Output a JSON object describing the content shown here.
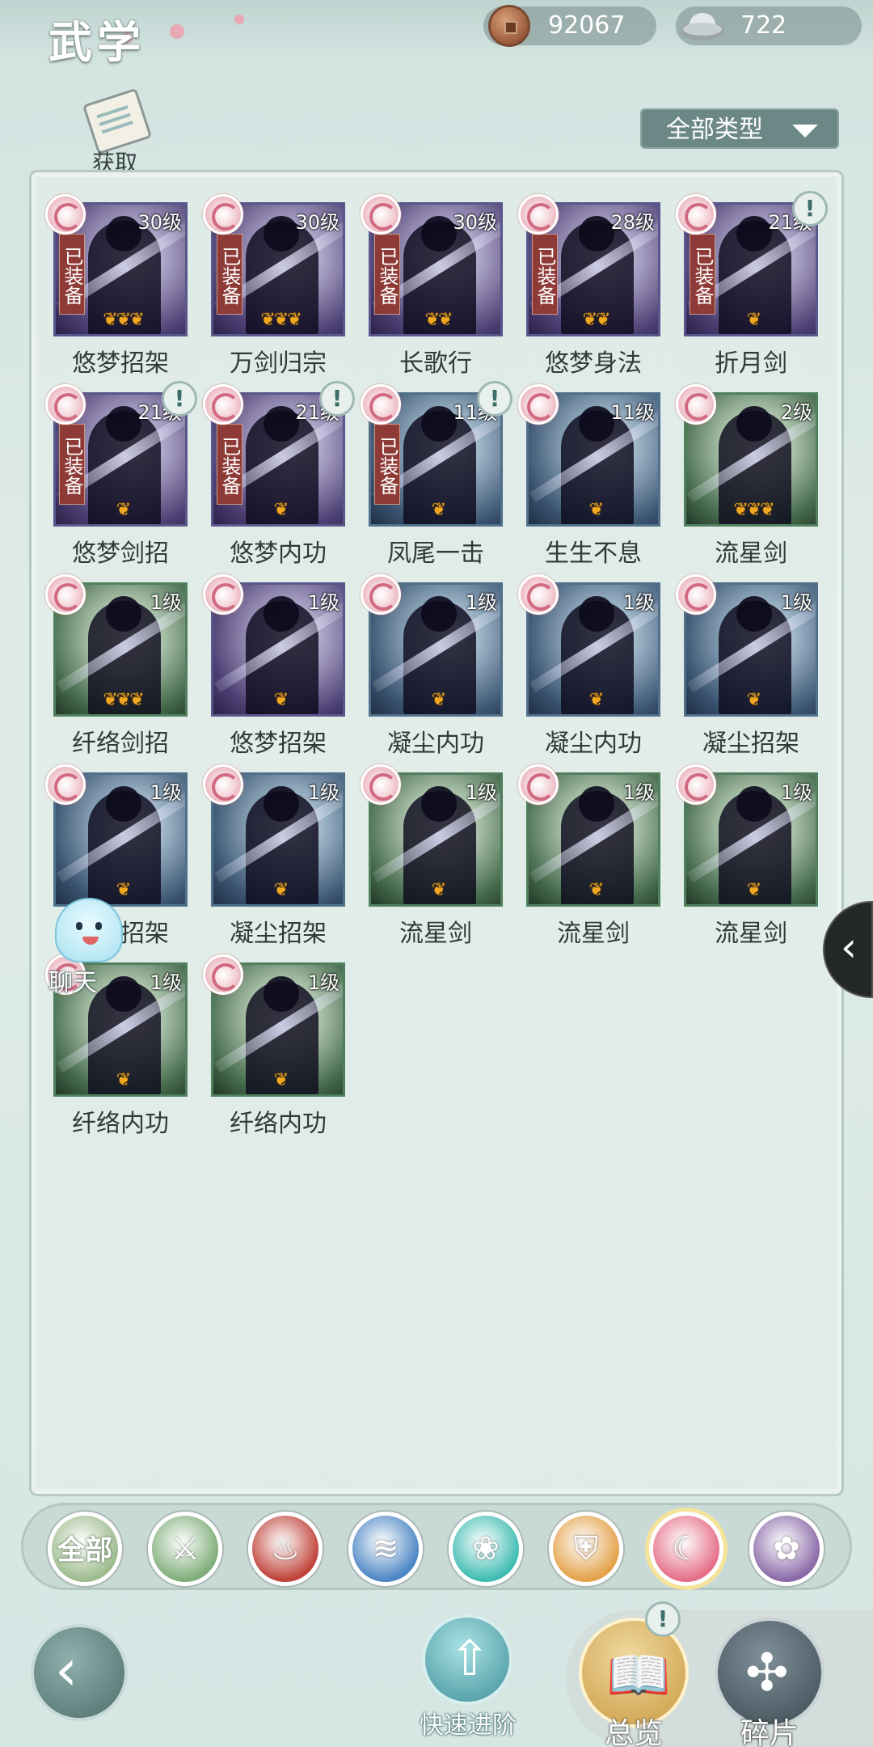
{
  "header": {
    "title": "武学",
    "coins": "92067",
    "silver": "722",
    "acquire_label": "获取",
    "filter_label": "全部类型"
  },
  "skills": [
    {
      "name": "悠梦招架",
      "level": "30级",
      "equipped": "已装备",
      "flames": 3,
      "alert": false,
      "tone": "purple"
    },
    {
      "name": "万剑归宗",
      "level": "30级",
      "equipped": "已装备",
      "flames": 3,
      "alert": false,
      "tone": "purple"
    },
    {
      "name": "长歌行",
      "level": "30级",
      "equipped": "已装备",
      "flames": 2,
      "alert": false,
      "tone": "purple"
    },
    {
      "name": "悠梦身法",
      "level": "28级",
      "equipped": "已装备",
      "flames": 2,
      "alert": false,
      "tone": "purple"
    },
    {
      "name": "折月剑",
      "level": "21级",
      "equipped": "已装备",
      "flames": 1,
      "alert": true,
      "tone": "purple"
    },
    {
      "name": "悠梦剑招",
      "level": "21级",
      "equipped": "已装备",
      "flames": 1,
      "alert": true,
      "tone": "purple"
    },
    {
      "name": "悠梦内功",
      "level": "21级",
      "equipped": "已装备",
      "flames": 1,
      "alert": true,
      "tone": "purple"
    },
    {
      "name": "凤尾一击",
      "level": "11级",
      "equipped": "已装备",
      "flames": 1,
      "alert": true,
      "tone": "blue"
    },
    {
      "name": "生生不息",
      "level": "11级",
      "equipped": "",
      "flames": 1,
      "alert": false,
      "tone": "blue"
    },
    {
      "name": "流星剑",
      "level": "2级",
      "equipped": "",
      "flames": 3,
      "alert": false,
      "tone": "green"
    },
    {
      "name": "纤络剑招",
      "level": "1级",
      "equipped": "",
      "flames": 3,
      "alert": false,
      "tone": "green"
    },
    {
      "name": "悠梦招架",
      "level": "1级",
      "equipped": "",
      "flames": 1,
      "alert": false,
      "tone": "purple"
    },
    {
      "name": "凝尘内功",
      "level": "1级",
      "equipped": "",
      "flames": 1,
      "alert": false,
      "tone": "blue"
    },
    {
      "name": "凝尘内功",
      "level": "1级",
      "equipped": "",
      "flames": 1,
      "alert": false,
      "tone": "blue"
    },
    {
      "name": "凝尘招架",
      "level": "1级",
      "equipped": "",
      "flames": 1,
      "alert": false,
      "tone": "blue"
    },
    {
      "name": "凝尘招架",
      "level": "1级",
      "equipped": "",
      "flames": 1,
      "alert": false,
      "tone": "blue"
    },
    {
      "name": "凝尘招架",
      "level": "1级",
      "equipped": "",
      "flames": 1,
      "alert": false,
      "tone": "blue"
    },
    {
      "name": "流星剑",
      "level": "1级",
      "equipped": "",
      "flames": 1,
      "alert": false,
      "tone": "green"
    },
    {
      "name": "流星剑",
      "level": "1级",
      "equipped": "",
      "flames": 1,
      "alert": false,
      "tone": "green"
    },
    {
      "name": "流星剑",
      "level": "1级",
      "equipped": "",
      "flames": 1,
      "alert": false,
      "tone": "green"
    },
    {
      "name": "纤络内功",
      "level": "1级",
      "equipped": "",
      "flames": 1,
      "alert": false,
      "tone": "green"
    },
    {
      "name": "纤络内功",
      "level": "1级",
      "equipped": "",
      "flames": 1,
      "alert": false,
      "tone": "green"
    }
  ],
  "chat_label": "聊天",
  "categories": [
    {
      "label": "全部",
      "icon": "all-icon",
      "color": "#9dbb8e",
      "active": false
    },
    {
      "label": "",
      "icon": "sword-icon",
      "color": "#7fae7a",
      "active": false
    },
    {
      "label": "",
      "icon": "flame-icon",
      "color": "#c0433a",
      "active": false
    },
    {
      "label": "",
      "icon": "wave-icon",
      "color": "#4c86c4",
      "active": false
    },
    {
      "label": "",
      "icon": "butterfly-icon",
      "color": "#3fbcb2",
      "active": false
    },
    {
      "label": "",
      "icon": "shield-icon",
      "color": "#e3a24a",
      "active": false
    },
    {
      "label": "",
      "icon": "moon-icon",
      "color": "#e56f88",
      "active": true
    },
    {
      "label": "",
      "icon": "rose-icon",
      "color": "#8b6aa8",
      "active": false
    }
  ],
  "bottom_nav": {
    "quick_advance": "快速进阶",
    "overview": "总览",
    "fragments": "碎片"
  }
}
